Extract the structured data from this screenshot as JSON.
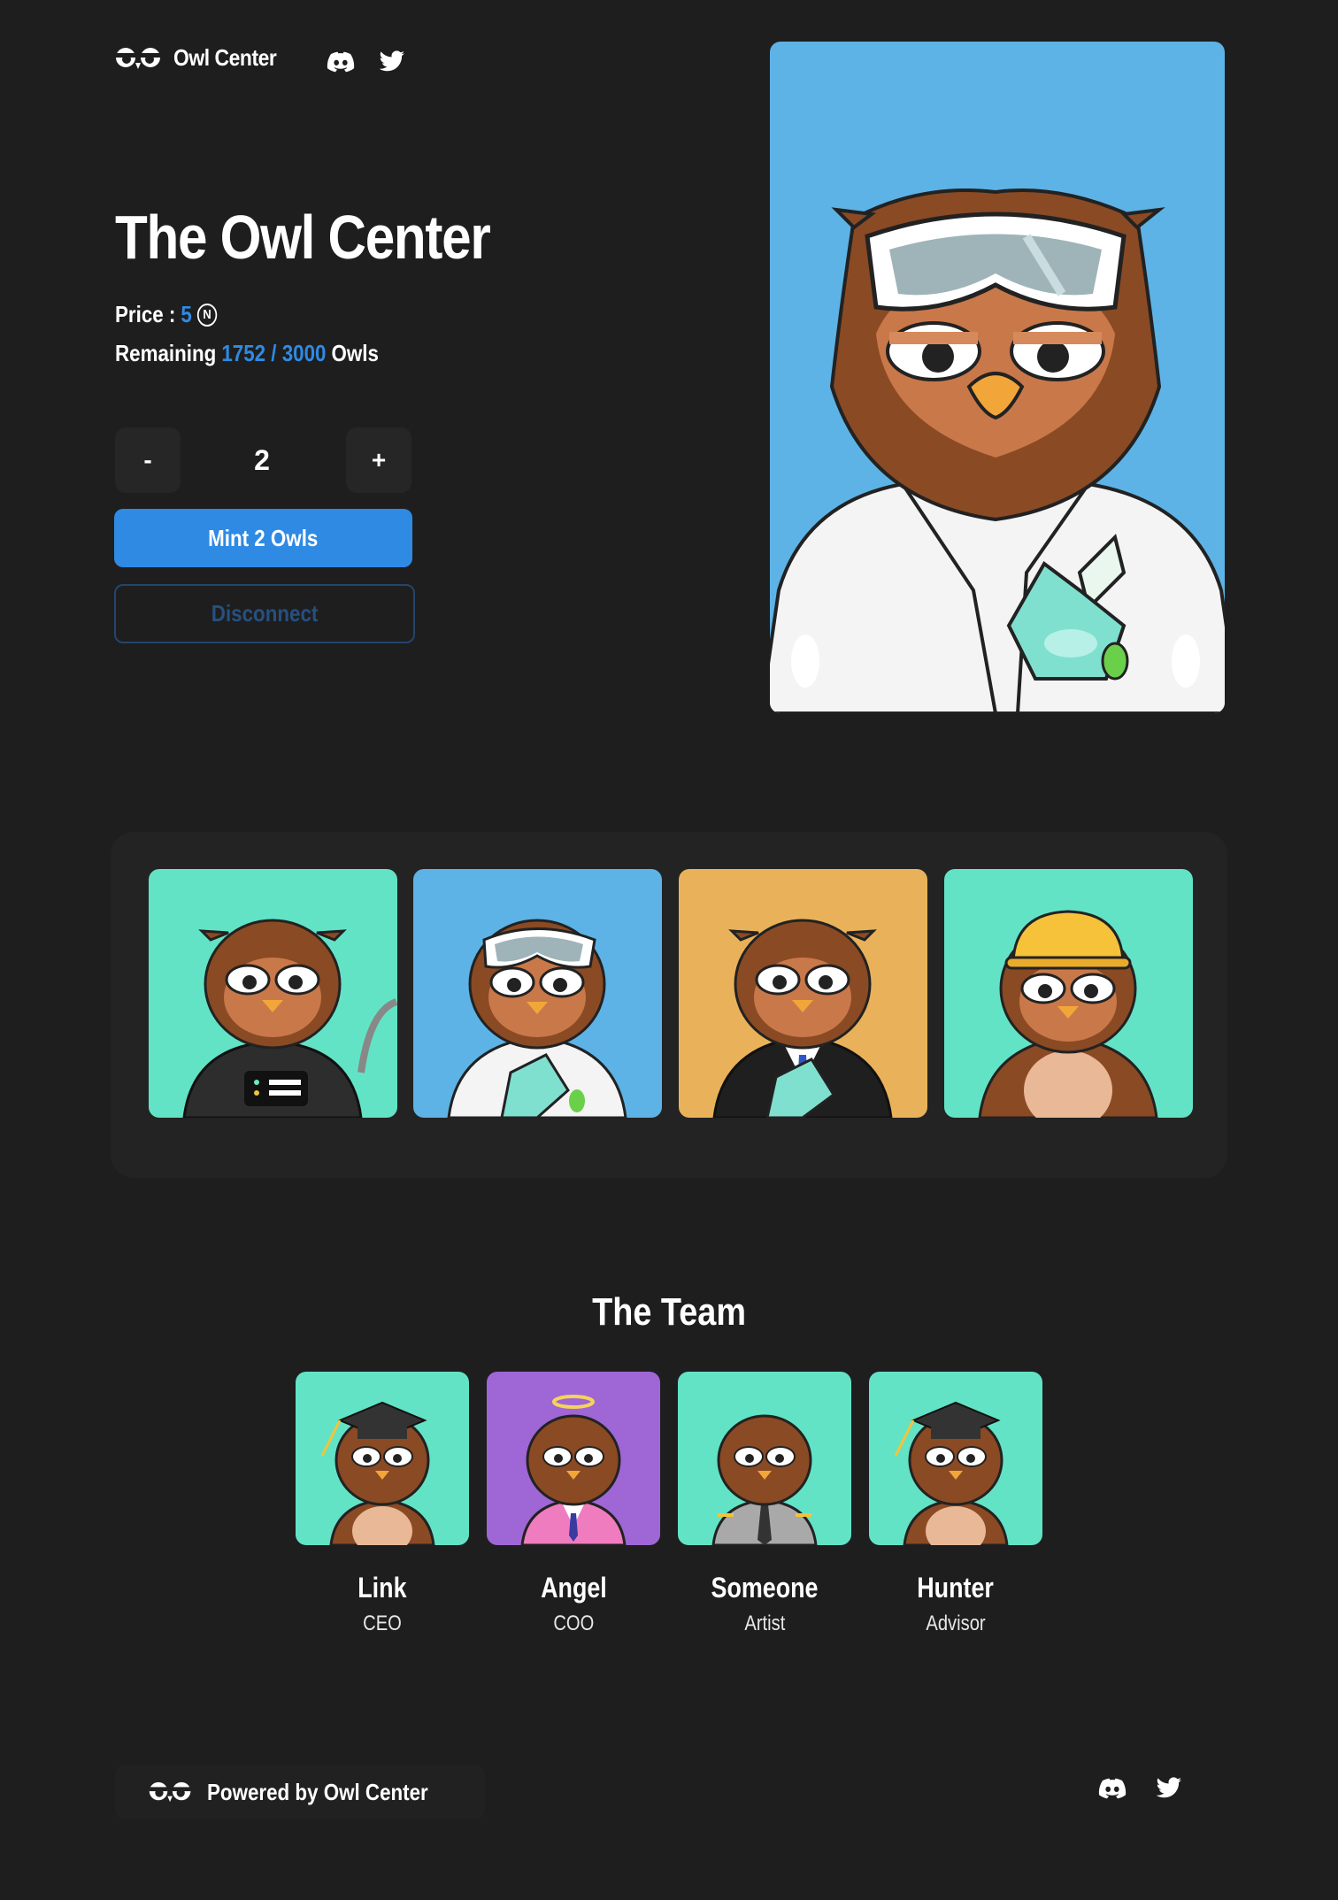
{
  "header": {
    "brand": "Owl Center",
    "social_icons": [
      "discord-icon",
      "twitter-icon"
    ]
  },
  "hero": {
    "title": "The Owl Center",
    "price_label": "Price :",
    "price_value": "5",
    "currency_icon": "near-icon",
    "currency_glyph": "N",
    "remaining_label": "Remaining",
    "remaining_value": "1752 / 3000",
    "remaining_unit": "Owls",
    "quantity": "2",
    "decrement_label": "-",
    "increment_label": "+",
    "mint_label": "Mint 2 Owls",
    "disconnect_label": "Disconnect"
  },
  "gallery": [
    {
      "name": "owl-astronaut",
      "bg": "#63e3c5"
    },
    {
      "name": "owl-scientist",
      "bg": "#5db3e6"
    },
    {
      "name": "owl-businessman",
      "bg": "#e9b25a"
    },
    {
      "name": "owl-builder",
      "bg": "#63e3c5"
    }
  ],
  "team": {
    "title": "The Team",
    "members": [
      {
        "name": "Link",
        "role": "CEO",
        "bg": "#63e3c5"
      },
      {
        "name": "Angel",
        "role": "COO",
        "bg": "#9f66d6"
      },
      {
        "name": "Someone",
        "role": "Artist",
        "bg": "#63e3c5"
      },
      {
        "name": "Hunter",
        "role": "Advisor",
        "bg": "#63e3c5"
      }
    ]
  },
  "footer": {
    "text": "Powered by Owl Center"
  },
  "colors": {
    "background": "#1e1e1e",
    "accent": "#2f8ae3",
    "disconnect_border": "#23456b"
  }
}
